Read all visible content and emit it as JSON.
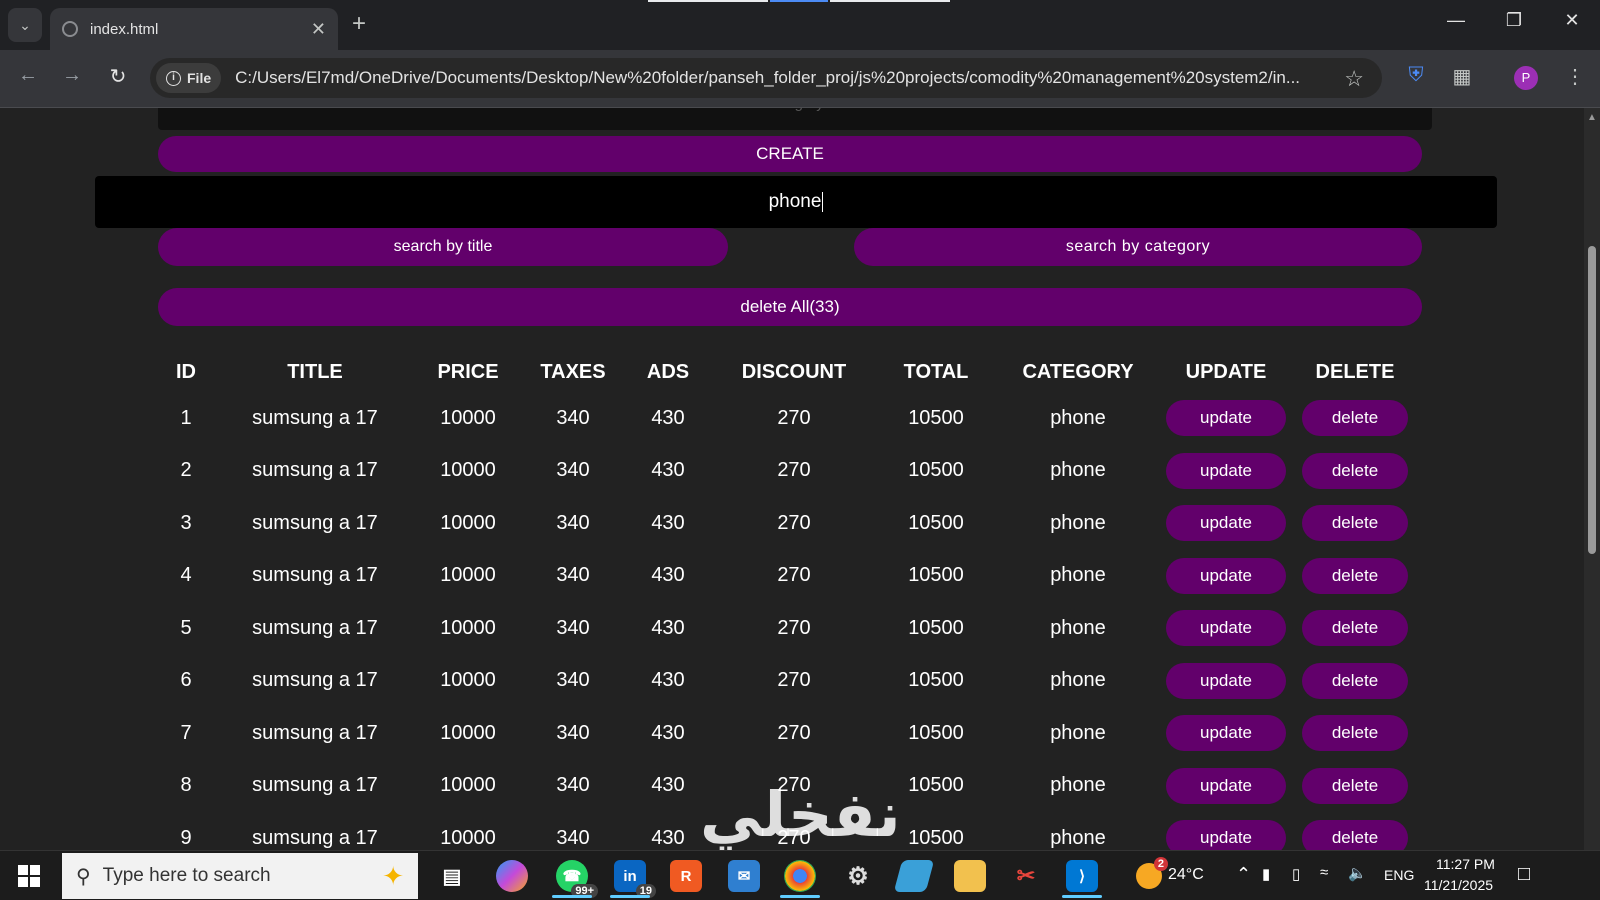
{
  "browser": {
    "tab_title": "index.html",
    "url_chip": "File",
    "url": "C:/Users/El7md/OneDrive/Documents/Desktop/New%20folder/panseh_folder_proj/js%20projects/comodity%20management%20system2/in...",
    "profile_initial": "P"
  },
  "form": {
    "category_placeholder": "category",
    "create_label": "CREATE",
    "search_value": "phone",
    "search_by_title": "search by title",
    "search_by_category": "search by category",
    "delete_all": "delete All(33)"
  },
  "table": {
    "headers": [
      "ID",
      "TITLE",
      "PRICE",
      "TAXES",
      "ADS",
      "DISCOUNT",
      "TOTAL",
      "CATEGORY",
      "UPDATE",
      "DELETE"
    ],
    "update_label": "update",
    "delete_label": "delete",
    "rows": [
      {
        "id": "1",
        "title": "sumsung a 17",
        "price": "10000",
        "taxes": "340",
        "ads": "430",
        "discount": "270",
        "total": "10500",
        "category": "phone"
      },
      {
        "id": "2",
        "title": "sumsung a 17",
        "price": "10000",
        "taxes": "340",
        "ads": "430",
        "discount": "270",
        "total": "10500",
        "category": "phone"
      },
      {
        "id": "3",
        "title": "sumsung a 17",
        "price": "10000",
        "taxes": "340",
        "ads": "430",
        "discount": "270",
        "total": "10500",
        "category": "phone"
      },
      {
        "id": "4",
        "title": "sumsung a 17",
        "price": "10000",
        "taxes": "340",
        "ads": "430",
        "discount": "270",
        "total": "10500",
        "category": "phone"
      },
      {
        "id": "5",
        "title": "sumsung a 17",
        "price": "10000",
        "taxes": "340",
        "ads": "430",
        "discount": "270",
        "total": "10500",
        "category": "phone"
      },
      {
        "id": "6",
        "title": "sumsung a 17",
        "price": "10000",
        "taxes": "340",
        "ads": "430",
        "discount": "270",
        "total": "10500",
        "category": "phone"
      },
      {
        "id": "7",
        "title": "sumsung a 17",
        "price": "10000",
        "taxes": "340",
        "ads": "430",
        "discount": "270",
        "total": "10500",
        "category": "phone"
      },
      {
        "id": "8",
        "title": "sumsung a 17",
        "price": "10000",
        "taxes": "340",
        "ads": "430",
        "discount": "270",
        "total": "10500",
        "category": "phone"
      },
      {
        "id": "9",
        "title": "sumsung a 17",
        "price": "10000",
        "taxes": "340",
        "ads": "430",
        "discount": "270",
        "total": "10500",
        "category": "phone"
      }
    ]
  },
  "watermark": "نفخلي",
  "taskbar": {
    "search_placeholder": "Type here to search",
    "whatsapp_badge": "99+",
    "linkedin_badge": "19",
    "weather_badge": "2",
    "temperature": "24°C",
    "language": "ENG",
    "time": "11:27 PM",
    "date": "11/21/2025"
  },
  "colors": {
    "accent_purple": "#62006b",
    "page_bg": "#222222",
    "search_bg": "#000000"
  }
}
